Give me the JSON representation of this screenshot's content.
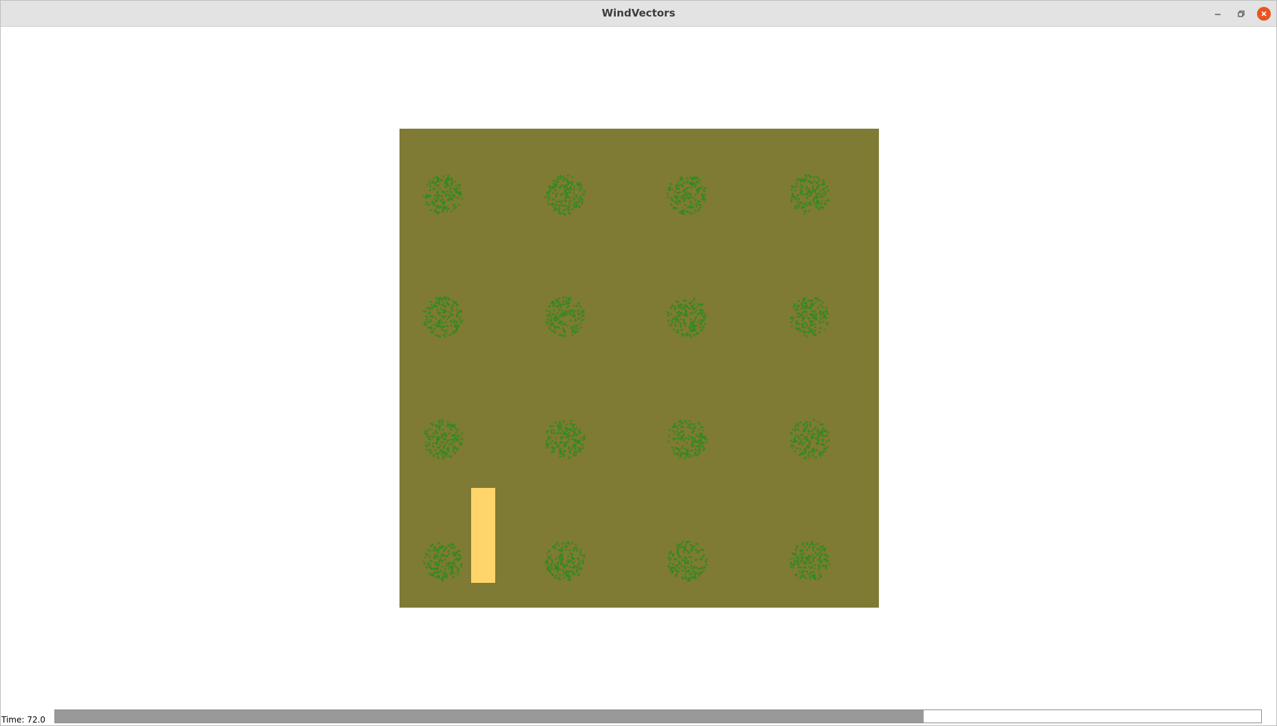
{
  "window": {
    "title": "WindVectors"
  },
  "titlebar_buttons": {
    "minimize_icon": "minimize-icon",
    "maximize_icon": "restore-icon",
    "close_icon": "close-icon"
  },
  "simulation": {
    "field_color": "#7f7a34",
    "plant_color": "#2e8b1e",
    "plant_rows": 4,
    "plant_cols": 4,
    "marker_color": "#ffd56b"
  },
  "status": {
    "time_label": "Time: 72.0"
  },
  "progress": {
    "fraction": 0.72
  }
}
